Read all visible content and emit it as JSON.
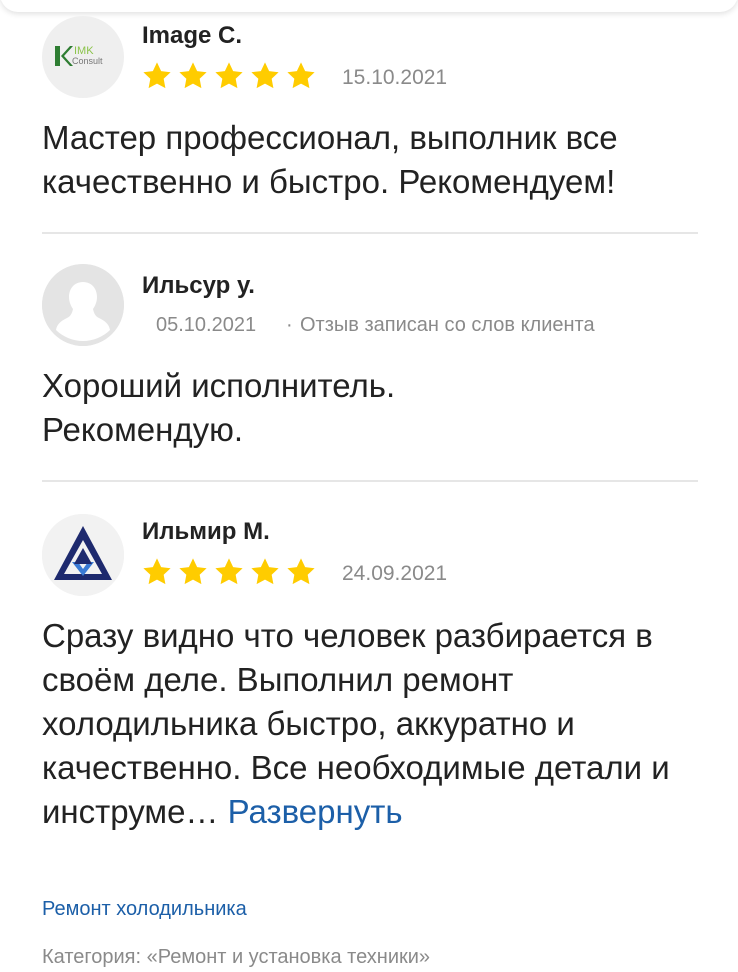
{
  "colors": {
    "star": "#ffcc00",
    "link": "#1c5fa8",
    "muted": "#8a8a8a"
  },
  "reviews": [
    {
      "author": "Image C.",
      "avatar_icon": "imk-consult-logo",
      "avatar_logo_text": "IMK Consult",
      "rating": 5,
      "date": "15.10.2021",
      "note": "",
      "text": "Мастер профессионал, выполник все качественно и быстро. Рекомендуем!"
    },
    {
      "author": "Ильсур у.",
      "avatar_icon": "default-user-avatar",
      "rating": 0,
      "date": "05.10.2021",
      "note": "Отзыв записан со слов клиента",
      "text": "Хороший исполнитель. Рекомендую."
    },
    {
      "author": "Ильмир М.",
      "avatar_icon": "triangle-logo-avatar",
      "rating": 5,
      "date": "24.09.2021",
      "note": "",
      "text": "Сразу видно что человек разбирается в своём деле. Выполнил ремонт холодильника быстро, аккуратно и качественно. Все необходимые детали и инструме…",
      "expand_label": "Развернуть",
      "service": "Ремонт холодильника",
      "category": "Категория: «Ремонт и установка техники»"
    }
  ]
}
